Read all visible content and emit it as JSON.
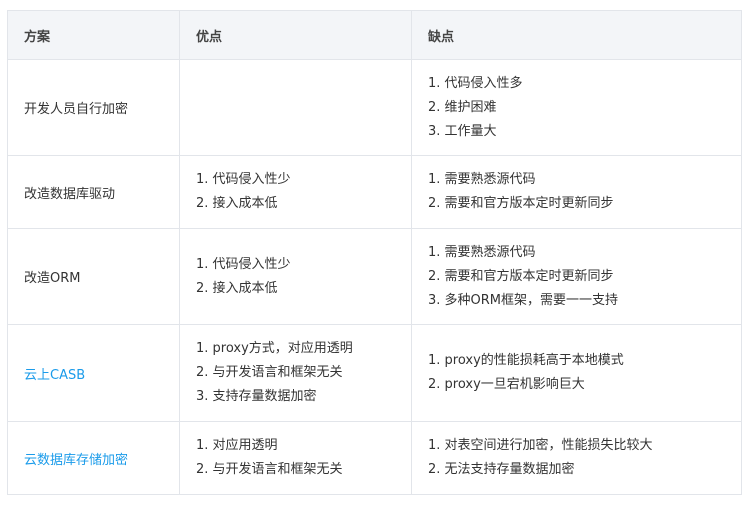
{
  "headers": [
    "方案",
    "优点",
    "缺点"
  ],
  "rows": [
    {
      "scheme": "开发人员自行加密",
      "pros": [],
      "cons": [
        "1. 代码侵入性多",
        "2. 维护困难",
        "3. 工作量大"
      ]
    },
    {
      "scheme": "改造数据库驱动",
      "pros": [
        "1. 代码侵入性少",
        "2. 接入成本低"
      ],
      "cons": [
        "1. 需要熟悉源代码",
        "2. 需要和官方版本定时更新同步"
      ]
    },
    {
      "scheme": "改造ORM",
      "pros": [
        "1. 代码侵入性少",
        "2. 接入成本低"
      ],
      "cons": [
        "1. 需要熟悉源代码",
        "2. 需要和官方版本定时更新同步",
        "3. 多种ORM框架，需要一一支持"
      ]
    },
    {
      "scheme": "云上CASB",
      "pros": [
        "1. proxy方式，对应用透明",
        "2. 与开发语言和框架无关",
        "3. 支持存量数据加密"
      ],
      "cons": [
        "1. proxy的性能损耗高于本地模式",
        "2. proxy一旦宕机影响巨大"
      ]
    },
    {
      "scheme": "云数据库存储加密",
      "pros": [
        "1. 对应用透明",
        "2. 与开发语言和框架无关"
      ],
      "cons": [
        "1. 对表空间进行加密，性能损失比较大",
        "2. 无法支持存量数据加密"
      ]
    }
  ],
  "colors": {
    "link": "#1a9bea",
    "header_bg": "#f3f5f8",
    "border": "#e2e5ea"
  }
}
